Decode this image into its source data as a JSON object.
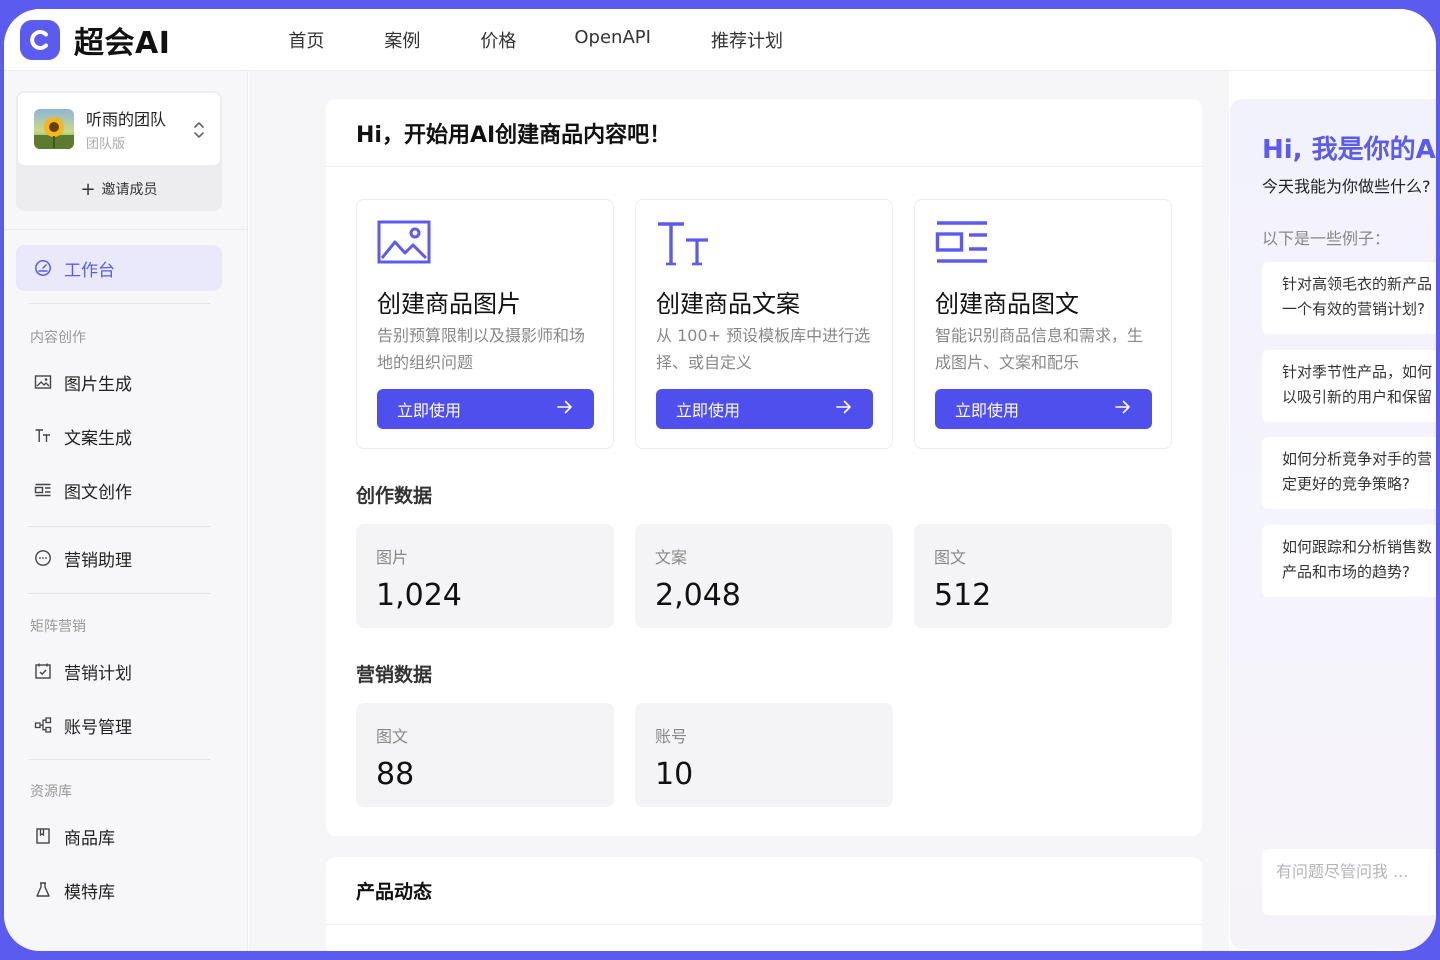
{
  "brand": {
    "name": "超会AI",
    "accent": "#5b5bf0"
  },
  "nav": [
    {
      "label": "首页"
    },
    {
      "label": "案例"
    },
    {
      "label": "价格"
    },
    {
      "label": "OpenAPI"
    },
    {
      "label": "推荐计划"
    }
  ],
  "sidebar": {
    "team": {
      "name": "听雨的团队",
      "plan": "团队版",
      "invite_label": "邀请成员"
    },
    "workspace": {
      "label": "工作台",
      "icon": "dashboard-icon"
    },
    "sections": [
      {
        "title": "内容创作",
        "items": [
          {
            "label": "图片生成",
            "icon": "image-icon"
          },
          {
            "label": "文案生成",
            "icon": "text-icon"
          },
          {
            "label": "图文创作",
            "icon": "layout-icon"
          }
        ]
      },
      {
        "title": "",
        "items": [
          {
            "label": "营销助理",
            "icon": "chat-icon"
          }
        ]
      },
      {
        "title": "矩阵营销",
        "items": [
          {
            "label": "营销计划",
            "icon": "calendar-icon"
          },
          {
            "label": "账号管理",
            "icon": "network-icon"
          }
        ]
      },
      {
        "title": "资源库",
        "items": [
          {
            "label": "商品库",
            "icon": "bookmark-icon"
          },
          {
            "label": "模特库",
            "icon": "model-icon"
          }
        ]
      }
    ]
  },
  "main": {
    "heading": "Hi，开始用AI创建商品内容吧！",
    "features": [
      {
        "title": "创建商品图片",
        "desc": "告别预算限制以及摄影师和场地的组织问题",
        "button": "立即使用",
        "icon": "image-icon"
      },
      {
        "title": "创建商品文案",
        "desc": "从 100+ 预设模板库中进行选择、或自定义",
        "button": "立即使用",
        "icon": "text-icon"
      },
      {
        "title": "创建商品图文",
        "desc": "智能识别商品信息和需求，生成图片、文案和配乐",
        "button": "立即使用",
        "icon": "layout-icon"
      }
    ],
    "creation_stats": {
      "title": "创作数据",
      "items": [
        {
          "label": "图片",
          "value": "1,024"
        },
        {
          "label": "文案",
          "value": "2,048"
        },
        {
          "label": "图文",
          "value": "512"
        }
      ]
    },
    "marketing_stats": {
      "title": "营销数据",
      "items": [
        {
          "label": "图文",
          "value": "88"
        },
        {
          "label": "账号",
          "value": "10"
        }
      ]
    },
    "product_news": {
      "title": "产品动态"
    }
  },
  "assistant": {
    "title": "Hi, 我是你的AI营",
    "subtitle": "今天我能为你做些什么?",
    "hint": "以下是一些例子：",
    "questions": [
      {
        "line1": "针对高领毛衣的新产品",
        "line2": "一个有效的营销计划?"
      },
      {
        "line1": "针对季节性产品，如何",
        "line2": "以吸引新的用户和保留"
      },
      {
        "line1": "如何分析竞争对手的营",
        "line2": "定更好的竞争策略?"
      },
      {
        "line1": "如何跟踪和分析销售数",
        "line2": "产品和市场的趋势?"
      }
    ],
    "input_placeholder": "有问题尽管问我 ..."
  }
}
